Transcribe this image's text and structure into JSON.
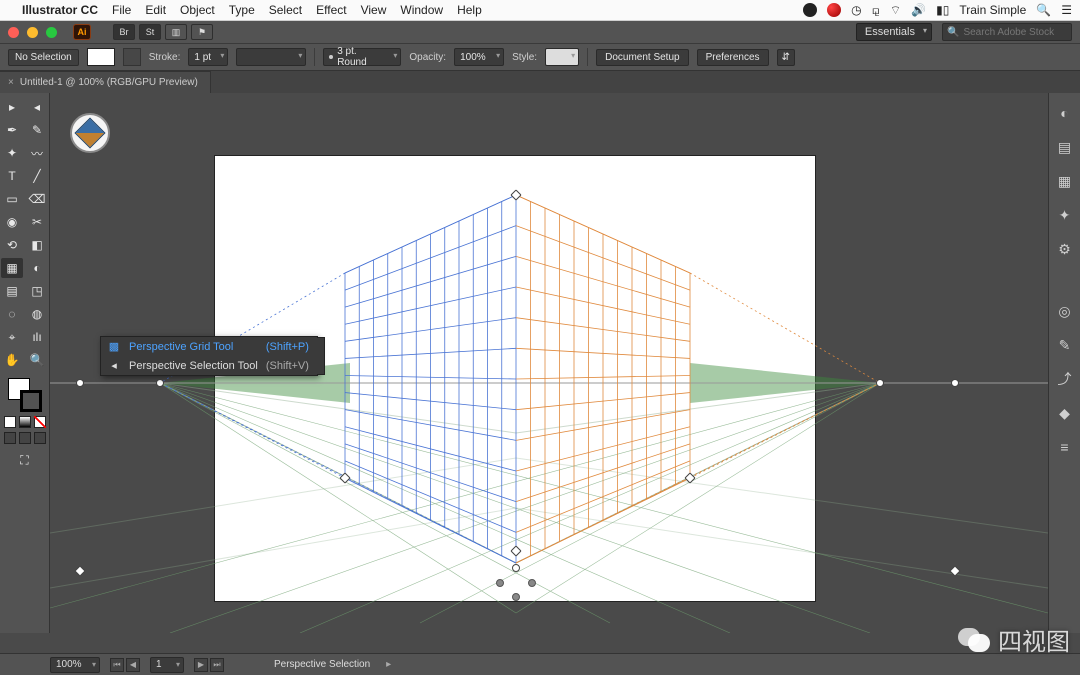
{
  "mac": {
    "app": "Illustrator CC",
    "menus": [
      "File",
      "Edit",
      "Object",
      "Type",
      "Select",
      "Effect",
      "View",
      "Window",
      "Help"
    ],
    "user": "Train Simple"
  },
  "workspace": {
    "name": "Essentials",
    "search_placeholder": "Search Adobe Stock"
  },
  "options": {
    "selection": "No Selection",
    "stroke_label": "Stroke:",
    "stroke_weight": "1 pt",
    "profile": "3 pt. Round",
    "opacity_label": "Opacity:",
    "opacity": "100%",
    "style_label": "Style:",
    "doc_setup": "Document Setup",
    "prefs": "Preferences"
  },
  "tab": {
    "title": "Untitled-1 @ 100% (RGB/GPU Preview)"
  },
  "flyout": {
    "items": [
      {
        "label": "Perspective Grid Tool",
        "shortcut": "(Shift+P)",
        "active": true
      },
      {
        "label": "Perspective Selection Tool",
        "shortcut": "(Shift+V)",
        "active": false
      }
    ]
  },
  "status": {
    "zoom": "100%",
    "artboard": "1",
    "tool": "Perspective Selection"
  },
  "watermark": "四视图",
  "tool_icons": [
    [
      "▸",
      "◂"
    ],
    [
      "✒",
      "✎"
    ],
    [
      "✦",
      "〰"
    ],
    [
      "T",
      "╱"
    ],
    [
      "▭",
      "⌫"
    ],
    [
      "◉",
      "✂"
    ],
    [
      "⟲",
      "◧"
    ],
    [
      "▦",
      "◐"
    ],
    [
      "▤",
      "◳"
    ],
    [
      "◌",
      "◍"
    ],
    [
      "⌖",
      "ılı"
    ],
    [
      "✋",
      "🔍"
    ]
  ],
  "dock_icons": [
    "◐",
    "▤",
    "▦",
    "✦",
    "⚙",
    "◎",
    "✎",
    "⤴",
    "◆",
    "≡"
  ]
}
